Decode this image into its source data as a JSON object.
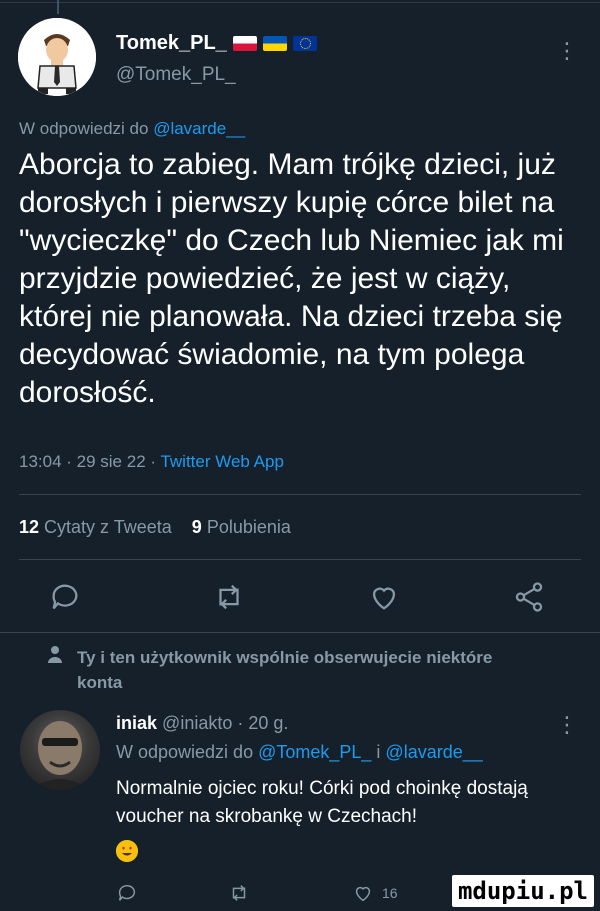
{
  "tweet": {
    "display_name": "Tomek_PL_",
    "handle": "@Tomek_PL_",
    "flags": [
      "pl-flag",
      "ua-flag",
      "eu-flag"
    ],
    "replying_prefix": "W odpowiedzi do ",
    "replying_mention": "@lavarde__",
    "text": "Aborcja to zabieg. Mam trójkę dzieci, już dorosłych i pierwszy kupię córce bilet na \"wycieczkę\" do Czech lub Niemiec jak mi przyjdzie powiedzieć, że jest w ciąży, której nie planowała. Na dzieci trzeba się decydować świadomie, na tym polega dorosłość.",
    "time": "13:04 · 29 sie 22 · ",
    "source": "Twitter Web App",
    "quote_count": "12",
    "quote_label": "Cytaty z Tweeta",
    "like_count": "9",
    "like_label": "Polubienia"
  },
  "social_context": {
    "text": "Ty i ten użytkownik wspólnie obserwujecie niektóre konta"
  },
  "reply": {
    "display_name": "iniak",
    "handle": "@iniakto",
    "age": "· 20 g.",
    "replying_prefix": "W odpowiedzi do ",
    "mention1": "@Tomek_PL_",
    "joiner": " i ",
    "mention2": "@lavarde__",
    "text": "Normalnie ojciec roku! Córki pod choinkę dostają voucher na skrobankę w Czechach!",
    "like_count": "16"
  },
  "watermark": "mdupiu.pl",
  "colors": {
    "background": "#15202b",
    "accent": "#1d9bf0",
    "muted": "#8899a6",
    "flag_pl_white": "#ffffff",
    "flag_pl_red": "#dc143c",
    "flag_ua_blue": "#0057b7",
    "flag_ua_yellow": "#ffd700",
    "flag_eu_blue": "#003399"
  }
}
